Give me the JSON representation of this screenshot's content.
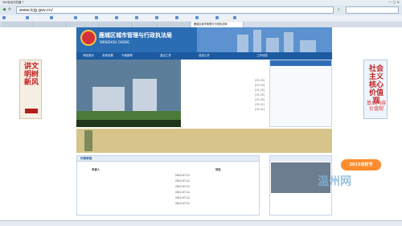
{
  "browser": {
    "window_title": "360安全浏览器 7",
    "url": "www.lcjg.gov.cn/",
    "bookmarks": [
      "",
      "",
      "",
      "",
      "",
      "",
      "",
      "",
      "",
      "",
      "",
      ""
    ],
    "tabs": [
      "",
      "",
      "",
      "",
      "",
      "",
      "鹿城区城市管理与行政执法局"
    ]
  },
  "site": {
    "title_cn": "鹿城区城市管理与行政执法局",
    "title_en": "WENZHOU CHENG",
    "nav": [
      "网站首页",
      "机构设置",
      "行政新闻",
      "",
      "重点工作",
      "",
      "信息公开",
      "",
      "",
      "工作动态",
      "",
      "",
      ""
    ],
    "photo_caption": "",
    "news_header": "",
    "news_items": [
      {
        "title": "",
        "date": "[03-25]"
      },
      {
        "title": "",
        "date": "[03-25]"
      },
      {
        "title": "",
        "date": "[03-25]"
      },
      {
        "title": "",
        "date": "[03-25]"
      },
      {
        "title": "",
        "date": "[03-25]"
      },
      {
        "title": "",
        "date": "[03-21]"
      },
      {
        "title": "",
        "date": "[03-21]"
      }
    ],
    "notice_header": "",
    "notice_items": [
      "",
      "",
      ""
    ],
    "slogan": "",
    "table": {
      "title": "行政审批",
      "hint": "",
      "columns": [
        "申请人",
        "",
        "",
        "状态"
      ],
      "rows": [
        {
          "applicant": "",
          "item": "",
          "date": "2012-07-11",
          "status": ""
        },
        {
          "applicant": "",
          "item": "",
          "date": "2012-07-11",
          "status": ""
        },
        {
          "applicant": "",
          "item": "",
          "date": "2012-07-11",
          "status": ""
        },
        {
          "applicant": "",
          "item": "",
          "date": "2012-07-11",
          "status": ""
        },
        {
          "applicant": "",
          "item": "",
          "date": "2012-07-11",
          "status": ""
        },
        {
          "applicant": "",
          "item": "",
          "date": "2012-07-11",
          "status": ""
        }
      ]
    },
    "left_ad": "讲文明树新风",
    "right_ad": "社会主义核心价值观",
    "right_ad_sub": "基本内容价值观",
    "watermark": "温州网",
    "badge": "2015米粉节"
  },
  "status": {
    "left": "",
    "right": ""
  },
  "colors": {
    "brand_blue": "#1c5aa2",
    "accent_orange": "#e07a0a",
    "slogan_red": "#c72d2d"
  }
}
